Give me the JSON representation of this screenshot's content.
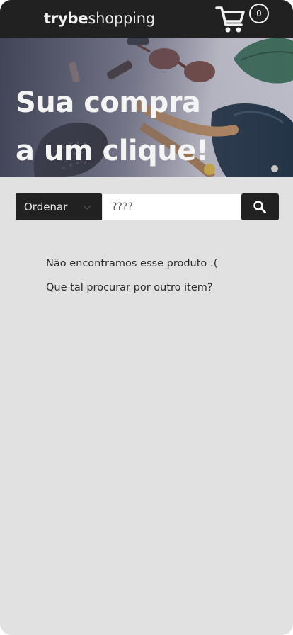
{
  "header": {
    "logo_bold": "trybe",
    "logo_light": "shopping",
    "cart_icon": "cart-icon",
    "cart_count": "0"
  },
  "hero": {
    "line1": "Sua compra",
    "line2": "a um clique!"
  },
  "search": {
    "sort_label": "Ordenar",
    "sort_icon": "chevron-down-icon",
    "query": "????",
    "button_icon": "search-icon"
  },
  "results": {
    "empty_line1": "Não encontramos esse produto :(",
    "empty_line2": "Que tal procurar por outro item?"
  },
  "colors": {
    "header_bg": "#212121",
    "page_bg": "#e1e1e1",
    "button_bg": "#212121"
  }
}
